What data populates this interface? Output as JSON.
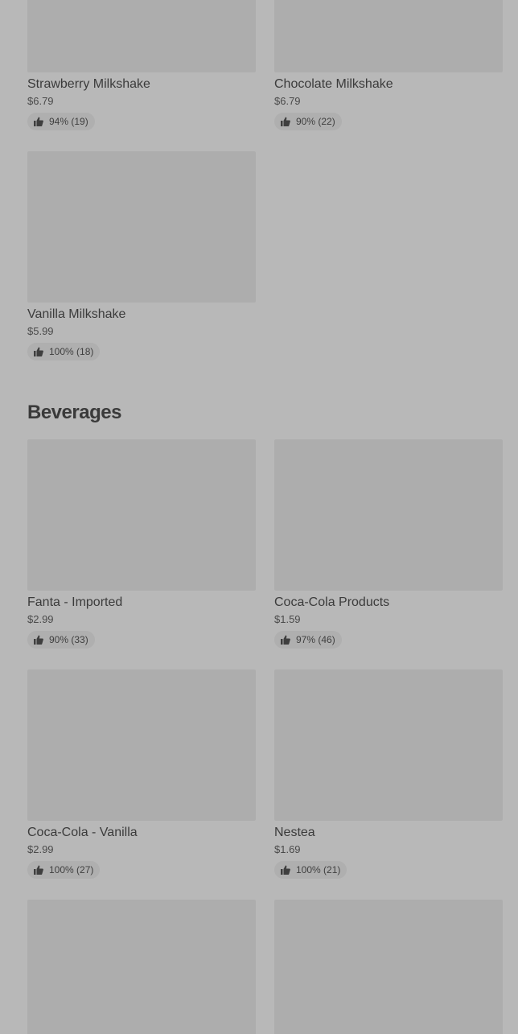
{
  "milkshakes": [
    {
      "name": "Strawberry Milkshake",
      "price": "$6.79",
      "rating": "94% (19)"
    },
    {
      "name": "Chocolate Milkshake",
      "price": "$6.79",
      "rating": "90% (22)"
    },
    {
      "name": "Vanilla Milkshake",
      "price": "$5.99",
      "rating": "100% (18)"
    }
  ],
  "beverages": {
    "title": "Beverages",
    "items": [
      {
        "name": "Fanta - Imported",
        "price": "$2.99",
        "rating": "90% (33)"
      },
      {
        "name": "Coca-Cola Products",
        "price": "$1.59",
        "rating": "97% (46)"
      },
      {
        "name": "Coca-Cola - Vanilla",
        "price": "$2.99",
        "rating": "100% (27)"
      },
      {
        "name": "Nestea",
        "price": "$1.69",
        "rating": "100% (21)"
      }
    ]
  },
  "icons": {
    "rating": "thumbs-up-icon"
  }
}
